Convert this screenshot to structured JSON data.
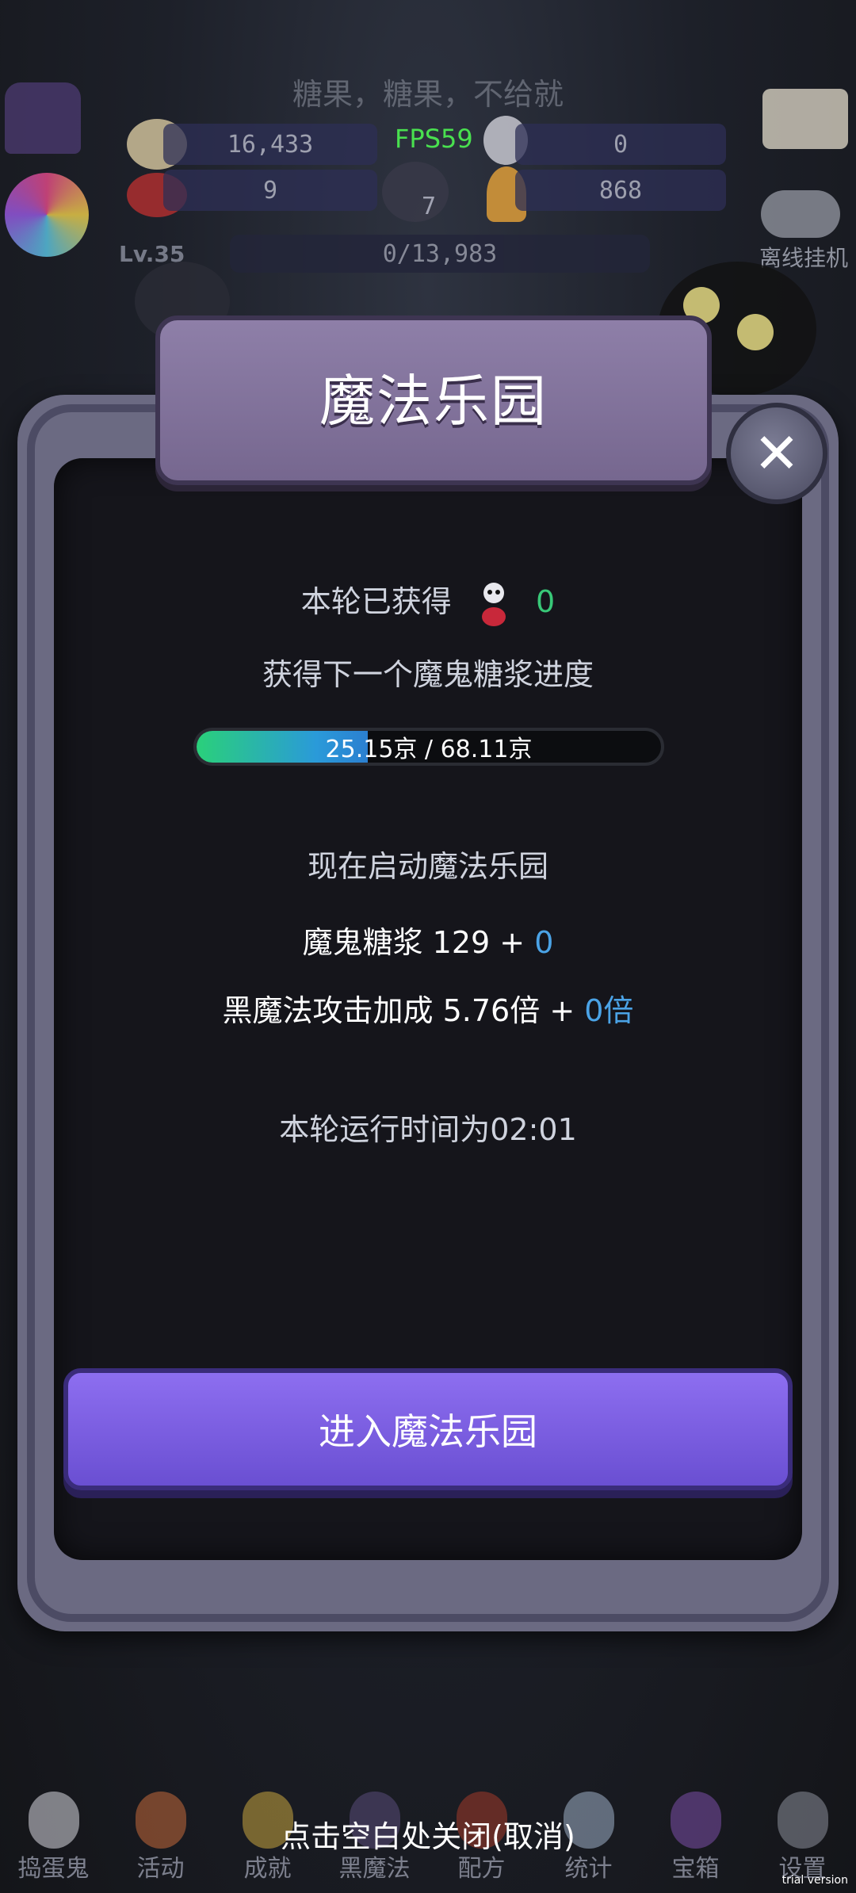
{
  "hud": {
    "game_title": "糖果，糖果，不给就",
    "candy_count": "16,433",
    "fps": "FPS59",
    "syrup_count": "0",
    "candy2_count": "9",
    "cauldron_count": "7",
    "corn_count": "868",
    "level": "Lv.35",
    "xp": "0/13,983",
    "offline_label": "离线挂机"
  },
  "dialog": {
    "title": "魔法乐园",
    "close_symbol": "✕",
    "obtained_label": "本轮已获得",
    "obtained_value": "0",
    "next_progress_label": "获得下一个魔鬼糖浆进度",
    "progress_text": "25.15京 / 68.11京",
    "progress_fraction": 0.369,
    "start_label": "现在启动魔法乐园",
    "syrup_label": "魔鬼糖浆 129 +",
    "syrup_bonus": "0",
    "attack_label": "黑魔法攻击加成 5.76倍 +",
    "attack_bonus": "0倍",
    "runtime_label": "本轮运行时间为02:01",
    "enter_button": "进入魔法乐园"
  },
  "close_hint": "点击空白处关闭(取消)",
  "nav": [
    {
      "label": "捣蛋鬼",
      "icon": "ghost-icon",
      "color": "#d8d8e0"
    },
    {
      "label": "活动",
      "icon": "eyeballs-icon",
      "color": "#c46a3a"
    },
    {
      "label": "成就",
      "icon": "skull-icon",
      "color": "#c9a640"
    },
    {
      "label": "黑魔法",
      "icon": "witch-hat-icon",
      "color": "#5a4c7a"
    },
    {
      "label": "配方",
      "icon": "book-icon",
      "color": "#a33a2a"
    },
    {
      "label": "统计",
      "icon": "crystal-ball-icon",
      "color": "#9fb0c8"
    },
    {
      "label": "宝箱",
      "icon": "treasure-chest-icon",
      "color": "#7b4fa8"
    },
    {
      "label": "设置",
      "icon": "gear-icon",
      "color": "#8c8f9a"
    }
  ],
  "watermark": "trial version"
}
